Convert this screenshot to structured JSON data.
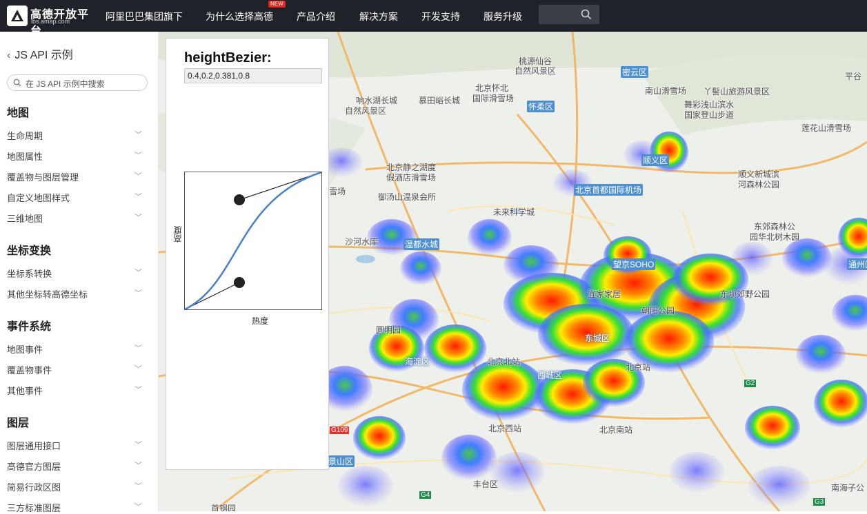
{
  "nav": {
    "logo_title": "高德开放平台",
    "logo_sub": "lbs.amap.com",
    "items": [
      "阿里巴巴集团旗下",
      "为什么选择高德",
      "产品介绍",
      "解决方案",
      "开发支持",
      "服务升级"
    ],
    "new_badge": "NEW"
  },
  "sidebar": {
    "back_label": "JS API 示例",
    "search_placeholder": "在 JS API 示例中搜索",
    "groups": [
      {
        "title": "地图",
        "items": [
          "生命周期",
          "地图属性",
          "覆盖物与图层管理",
          "自定义地图样式",
          "三维地图"
        ]
      },
      {
        "title": "坐标变换",
        "items": [
          "坐标系转换",
          "其他坐标转高德坐标"
        ]
      },
      {
        "title": "事件系统",
        "items": [
          "地图事件",
          "覆盖物事件",
          "其他事件"
        ]
      },
      {
        "title": "图层",
        "items": [
          "图层通用接口",
          "高德官方图层",
          "简易行政区图",
          "三方标准图层"
        ]
      }
    ]
  },
  "panel": {
    "title": "heightBezier:",
    "value": "0.4,0.2,0.381,0.8",
    "xlabel": "热度",
    "ylabel": "高度"
  },
  "map": {
    "labels": [
      "桃源仙谷",
      "自然风景区",
      "密云区",
      "平谷",
      "南山滑雪场",
      "丫髻山旅游风景区",
      "响水湖长城",
      "自然风景区",
      "慕田峪长城",
      "北京怀北",
      "国际滑雪场",
      "怀柔区",
      "舞彩浅山滨水",
      "国家登山步道",
      "莲花山滑雪场",
      "北京静之湖度",
      "假酒店滑雪场",
      "顺义区",
      "顺义新城滨",
      "河森林公园",
      "雪场",
      "御汤山温泉会所",
      "北京首都国际机场",
      "未来科学城",
      "东郊森林公",
      "园华北树木园",
      "沙河水库",
      "温都水城",
      "望京SOHO",
      "通州区",
      "宜家家居",
      "朝阳公园",
      "东坝郊野公园",
      "圆明园",
      "东城区",
      "海淀区",
      "北京北站",
      "北京站",
      "西城区",
      "北京西站",
      "北京南站",
      "G109",
      "G2",
      "景山区",
      "丰台区",
      "G4",
      "南海子公",
      "G3",
      "首钢园"
    ]
  }
}
